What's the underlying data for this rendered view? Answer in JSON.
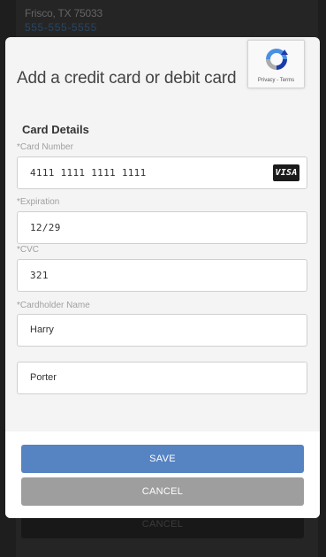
{
  "background": {
    "address": "Frisco, TX 75033",
    "phone": "555-555-5555",
    "cancel_label": "CANCEL"
  },
  "modal": {
    "title": "Add a credit card or debit card",
    "recaptcha_links": "Privacy - Terms",
    "section_title": "Card Details",
    "fields": {
      "card_number": {
        "label": "*Card Number",
        "value": "4111 1111 1111 1111",
        "brand": "VISA"
      },
      "expiration": {
        "label": "*Expiration",
        "value": "12/29"
      },
      "cvc": {
        "label": "*CVC",
        "value": "321"
      },
      "first_name": {
        "label": "*Cardholder Name",
        "value": "Harry"
      },
      "last_name": {
        "value": "Porter"
      }
    },
    "buttons": {
      "save": "SAVE",
      "cancel": "CANCEL"
    }
  },
  "colors": {
    "save_button": "#5683c2",
    "cancel_button": "#9e9e9e",
    "modal_bg": "#f4f4f4"
  }
}
